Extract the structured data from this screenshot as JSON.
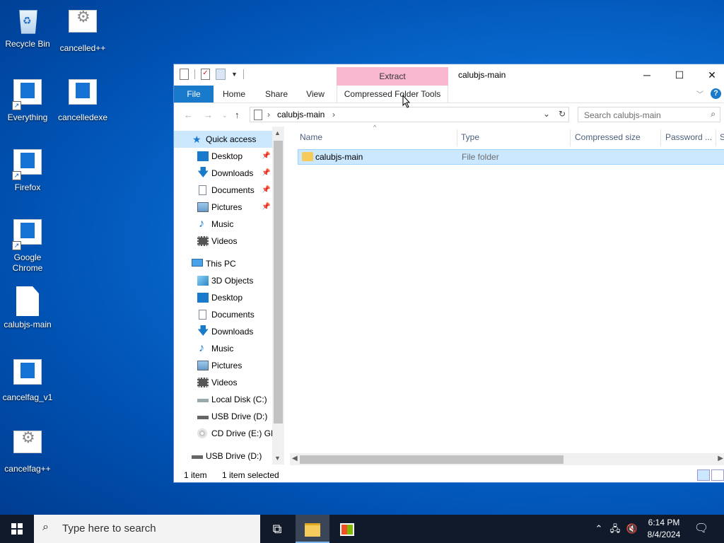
{
  "desktop": {
    "icons": [
      {
        "label": "Recycle Bin",
        "icon": "recycle-bin-icon"
      },
      {
        "label": "cancelled++",
        "icon": "settings-app-icon"
      },
      {
        "label": "Everything",
        "icon": "app-window-icon"
      },
      {
        "label": "cancelledexe",
        "icon": "app-window-icon"
      },
      {
        "label": "Firefox",
        "icon": "app-window-icon"
      },
      {
        "label": "Google Chrome",
        "icon": "app-window-icon"
      },
      {
        "label": "calubjs-main",
        "icon": "document-icon"
      },
      {
        "label": "cancelfag_v1",
        "icon": "app-window-icon"
      },
      {
        "label": "cancelfag++",
        "icon": "settings-app-icon"
      }
    ]
  },
  "window": {
    "title": "calubjs-main",
    "context_tab": "Extract",
    "ribbon_tabs": {
      "file": "File",
      "home": "Home",
      "share": "Share",
      "view": "View",
      "compressed": "Compressed Folder Tools"
    },
    "controls": {
      "minimize": "─",
      "maximize": "☐",
      "close": "✕"
    },
    "help": "?",
    "address": {
      "crumb": "calubjs-main"
    },
    "search": {
      "placeholder": "Search calubjs-main"
    },
    "nav_pane": {
      "quick_access": "Quick access",
      "quick_items": [
        "Desktop",
        "Downloads",
        "Documents",
        "Pictures",
        "Music",
        "Videos"
      ],
      "this_pc": "This PC",
      "pc_items": [
        "3D Objects",
        "Desktop",
        "Documents",
        "Downloads",
        "Music",
        "Pictures",
        "Videos",
        "Local Disk (C:)",
        "USB Drive (D:)",
        "CD Drive (E:) GP."
      ],
      "usb_bottom": "USB Drive (D:)"
    },
    "columns": [
      "Name",
      "Type",
      "Compressed size",
      "Password ...",
      "S"
    ],
    "rows": [
      {
        "name": "calubjs-main",
        "type": "File folder"
      }
    ],
    "status": {
      "count": "1 item",
      "selected": "1 item selected"
    }
  },
  "taskbar": {
    "search_placeholder": "Type here to search",
    "time": "6:14 PM",
    "date": "8/4/2024"
  },
  "colors": {
    "accent": "#1979ca",
    "context_tab": "#f9b7d0",
    "selection": "#cce8ff",
    "taskbar": "#101a2b"
  }
}
